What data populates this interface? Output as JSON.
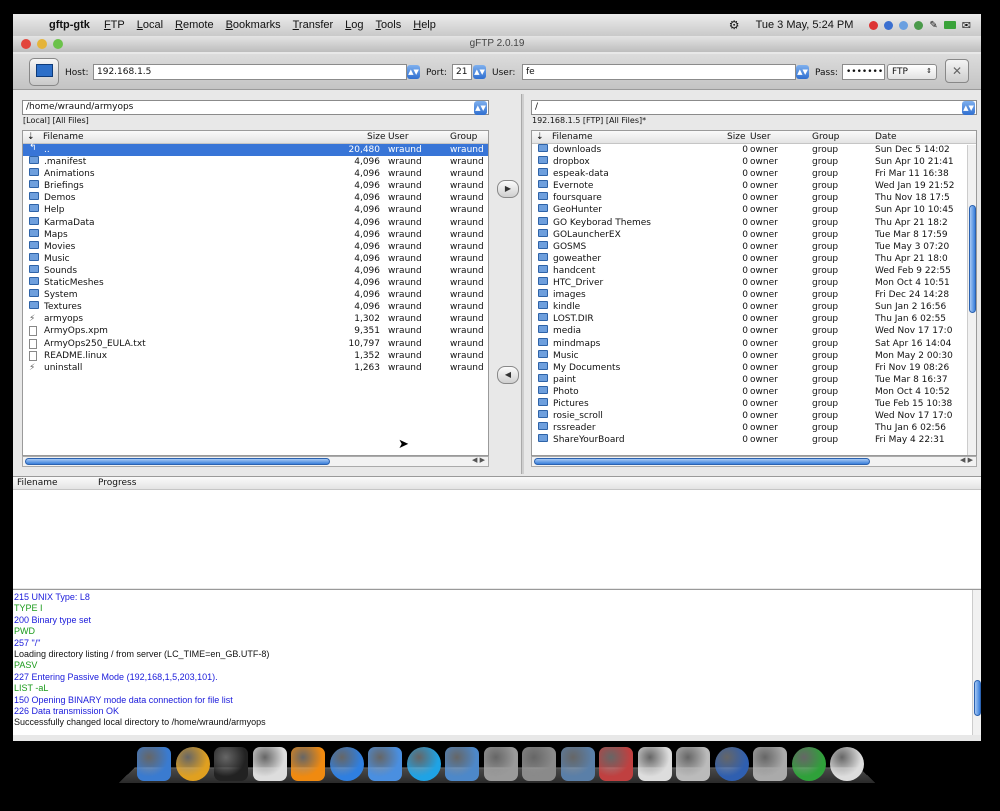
{
  "menubar": {
    "app_name": "gftp-gtk",
    "menus": [
      "FTP",
      "Local",
      "Remote",
      "Bookmarks",
      "Transfer",
      "Log",
      "Tools",
      "Help"
    ],
    "clock": "Tue  3 May,  5:24 PM"
  },
  "window": {
    "title": "gFTP 2.0.19"
  },
  "toolbar": {
    "host_label": "Host:",
    "host_value": "192.168.1.5",
    "port_label": "Port:",
    "port_value": "21",
    "user_label": "User:",
    "user_value": "fe",
    "pass_label": "Pass:",
    "pass_value": "•••••••",
    "protocol": "FTP"
  },
  "local": {
    "path": "/home/wraund/armyops",
    "info": "[Local] [All Files]",
    "columns": {
      "name": "Filename",
      "size": "Size",
      "user": "User",
      "group": "Group"
    },
    "rows": [
      {
        "icon": "up",
        "name": "..",
        "size": "20,480",
        "user": "wraund",
        "group": "wraund"
      },
      {
        "icon": "folder",
        "name": ".manifest",
        "size": "4,096",
        "user": "wraund",
        "group": "wraund"
      },
      {
        "icon": "folder",
        "name": "Animations",
        "size": "4,096",
        "user": "wraund",
        "group": "wraund"
      },
      {
        "icon": "folder",
        "name": "Briefings",
        "size": "4,096",
        "user": "wraund",
        "group": "wraund"
      },
      {
        "icon": "folder",
        "name": "Demos",
        "size": "4,096",
        "user": "wraund",
        "group": "wraund"
      },
      {
        "icon": "folder",
        "name": "Help",
        "size": "4,096",
        "user": "wraund",
        "group": "wraund"
      },
      {
        "icon": "folder",
        "name": "KarmaData",
        "size": "4,096",
        "user": "wraund",
        "group": "wraund"
      },
      {
        "icon": "folder",
        "name": "Maps",
        "size": "4,096",
        "user": "wraund",
        "group": "wraund"
      },
      {
        "icon": "folder",
        "name": "Movies",
        "size": "4,096",
        "user": "wraund",
        "group": "wraund"
      },
      {
        "icon": "folder",
        "name": "Music",
        "size": "4,096",
        "user": "wraund",
        "group": "wraund"
      },
      {
        "icon": "folder",
        "name": "Sounds",
        "size": "4,096",
        "user": "wraund",
        "group": "wraund"
      },
      {
        "icon": "folder",
        "name": "StaticMeshes",
        "size": "4,096",
        "user": "wraund",
        "group": "wraund"
      },
      {
        "icon": "folder",
        "name": "System",
        "size": "4,096",
        "user": "wraund",
        "group": "wraund"
      },
      {
        "icon": "folder",
        "name": "Textures",
        "size": "4,096",
        "user": "wraund",
        "group": "wraund"
      },
      {
        "icon": "exec",
        "name": "armyops",
        "size": "1,302",
        "user": "wraund",
        "group": "wraund"
      },
      {
        "icon": "file",
        "name": "ArmyOps.xpm",
        "size": "9,351",
        "user": "wraund",
        "group": "wraund"
      },
      {
        "icon": "file",
        "name": "ArmyOps250_EULA.txt",
        "size": "10,797",
        "user": "wraund",
        "group": "wraund"
      },
      {
        "icon": "file",
        "name": "README.linux",
        "size": "1,352",
        "user": "wraund",
        "group": "wraund"
      },
      {
        "icon": "exec",
        "name": "uninstall",
        "size": "1,263",
        "user": "wraund",
        "group": "wraund"
      }
    ]
  },
  "remote": {
    "path": "/",
    "info": "192.168.1.5 [FTP] [All Files]*",
    "columns": {
      "name": "Filename",
      "size": "Size",
      "user": "User",
      "group": "Group",
      "date": "Date"
    },
    "rows": [
      {
        "name": "downloads",
        "size": "0",
        "user": "owner",
        "group": "group",
        "date": "Sun Dec  5 14:02"
      },
      {
        "name": "dropbox",
        "size": "0",
        "user": "owner",
        "group": "group",
        "date": "Sun Apr 10 21:41"
      },
      {
        "name": "espeak-data",
        "size": "0",
        "user": "owner",
        "group": "group",
        "date": "Fri Mar 11 16:38"
      },
      {
        "name": "Evernote",
        "size": "0",
        "user": "owner",
        "group": "group",
        "date": "Wed Jan 19 21:52"
      },
      {
        "name": "foursquare",
        "size": "0",
        "user": "owner",
        "group": "group",
        "date": "Thu Nov 18 17:5"
      },
      {
        "name": "GeoHunter",
        "size": "0",
        "user": "owner",
        "group": "group",
        "date": "Sun Apr 10 10:45"
      },
      {
        "name": "GO Keyborad Themes",
        "size": "0",
        "user": "owner",
        "group": "group",
        "date": "Thu Apr 21 18:2"
      },
      {
        "name": "GOLauncherEX",
        "size": "0",
        "user": "owner",
        "group": "group",
        "date": "Tue Mar  8 17:59"
      },
      {
        "name": "GOSMS",
        "size": "0",
        "user": "owner",
        "group": "group",
        "date": "Tue May  3 07:20"
      },
      {
        "name": "goweather",
        "size": "0",
        "user": "owner",
        "group": "group",
        "date": "Thu Apr 21 18:0"
      },
      {
        "name": "handcent",
        "size": "0",
        "user": "owner",
        "group": "group",
        "date": "Wed Feb  9 22:55"
      },
      {
        "name": "HTC_Driver",
        "size": "0",
        "user": "owner",
        "group": "group",
        "date": "Mon Oct  4 10:51"
      },
      {
        "name": "images",
        "size": "0",
        "user": "owner",
        "group": "group",
        "date": "Fri Dec 24 14:28"
      },
      {
        "name": "kindle",
        "size": "0",
        "user": "owner",
        "group": "group",
        "date": "Sun Jan  2 16:56"
      },
      {
        "name": "LOST.DIR",
        "size": "0",
        "user": "owner",
        "group": "group",
        "date": "Thu Jan  6 02:55"
      },
      {
        "name": "media",
        "size": "0",
        "user": "owner",
        "group": "group",
        "date": "Wed Nov 17 17:0"
      },
      {
        "name": "mindmaps",
        "size": "0",
        "user": "owner",
        "group": "group",
        "date": "Sat Apr 16 14:04"
      },
      {
        "name": "Music",
        "size": "0",
        "user": "owner",
        "group": "group",
        "date": "Mon May  2 00:30"
      },
      {
        "name": "My Documents",
        "size": "0",
        "user": "owner",
        "group": "group",
        "date": "Fri Nov 19 08:26"
      },
      {
        "name": "paint",
        "size": "0",
        "user": "owner",
        "group": "group",
        "date": "Tue Mar  8 16:37"
      },
      {
        "name": "Photo",
        "size": "0",
        "user": "owner",
        "group": "group",
        "date": "Mon Oct  4 10:52"
      },
      {
        "name": "Pictures",
        "size": "0",
        "user": "owner",
        "group": "group",
        "date": "Tue Feb 15 10:38"
      },
      {
        "name": "rosie_scroll",
        "size": "0",
        "user": "owner",
        "group": "group",
        "date": "Wed Nov 17 17:0"
      },
      {
        "name": "rssreader",
        "size": "0",
        "user": "owner",
        "group": "group",
        "date": "Thu Jan  6 02:56"
      },
      {
        "name": "ShareYourBoard",
        "size": "0",
        "user": "owner",
        "group": "group",
        "date": "Fri May  4 22:31"
      }
    ]
  },
  "queue": {
    "columns": {
      "name": "Filename",
      "progress": "Progress"
    }
  },
  "log": [
    {
      "text": "215 UNIX Type: L8",
      "color": "#1a1adb"
    },
    {
      "text": "TYPE I",
      "color": "#1a9a1a"
    },
    {
      "text": "200 Binary type set",
      "color": "#1a1adb"
    },
    {
      "text": "PWD",
      "color": "#1a9a1a"
    },
    {
      "text": "257 \"/\"",
      "color": "#1a1adb"
    },
    {
      "text": "Loading directory listing / from server (LC_TIME=en_GB.UTF-8)",
      "color": "#111111"
    },
    {
      "text": "PASV",
      "color": "#1a9a1a"
    },
    {
      "text": "227 Entering Passive Mode (192,168,1,5,203,101).",
      "color": "#1a1adb"
    },
    {
      "text": "LIST -aL",
      "color": "#1a9a1a"
    },
    {
      "text": "150 Opening BINARY mode data connection for file list",
      "color": "#1a1adb"
    },
    {
      "text": "226 Data transmission OK",
      "color": "#1a1adb"
    },
    {
      "text": "Successfully changed local directory to /home/wraund/armyops",
      "color": "#111111"
    }
  ],
  "dock": {
    "icons": [
      {
        "name": "anchor-icon",
        "color": "#3a7bd0"
      },
      {
        "name": "chrome-icon",
        "color": "#e0a020"
      },
      {
        "name": "terminal-icon",
        "color": "#222222"
      },
      {
        "name": "x11-icon",
        "color": "#dddddd"
      },
      {
        "name": "vlc-icon",
        "color": "#f08a10"
      },
      {
        "name": "quicktime-icon",
        "color": "#2f7fe0"
      },
      {
        "name": "finder-icon",
        "color": "#4a8fe0"
      },
      {
        "name": "skype-icon",
        "color": "#1fa3e5"
      },
      {
        "name": "preview-icon",
        "color": "#4d88c9"
      },
      {
        "name": "calculator-icon",
        "color": "#9a9a9a"
      },
      {
        "name": "system-preferences-icon",
        "color": "#8a8a8a"
      },
      {
        "name": "textedit-icon",
        "color": "#5a7fa8"
      },
      {
        "name": "photo-booth-icon",
        "color": "#c04040"
      },
      {
        "name": "script-editor-icon",
        "color": "#dddddd"
      },
      {
        "name": "typewriter-icon",
        "color": "#bbbbbb"
      },
      {
        "name": "network-icon",
        "color": "#2f5fb0"
      },
      {
        "name": "trash-icon",
        "color": "#aaaaaa"
      },
      {
        "name": "green-globe-icon",
        "color": "#2fa13a"
      },
      {
        "name": "clock-icon",
        "color": "#dddddd"
      }
    ]
  }
}
